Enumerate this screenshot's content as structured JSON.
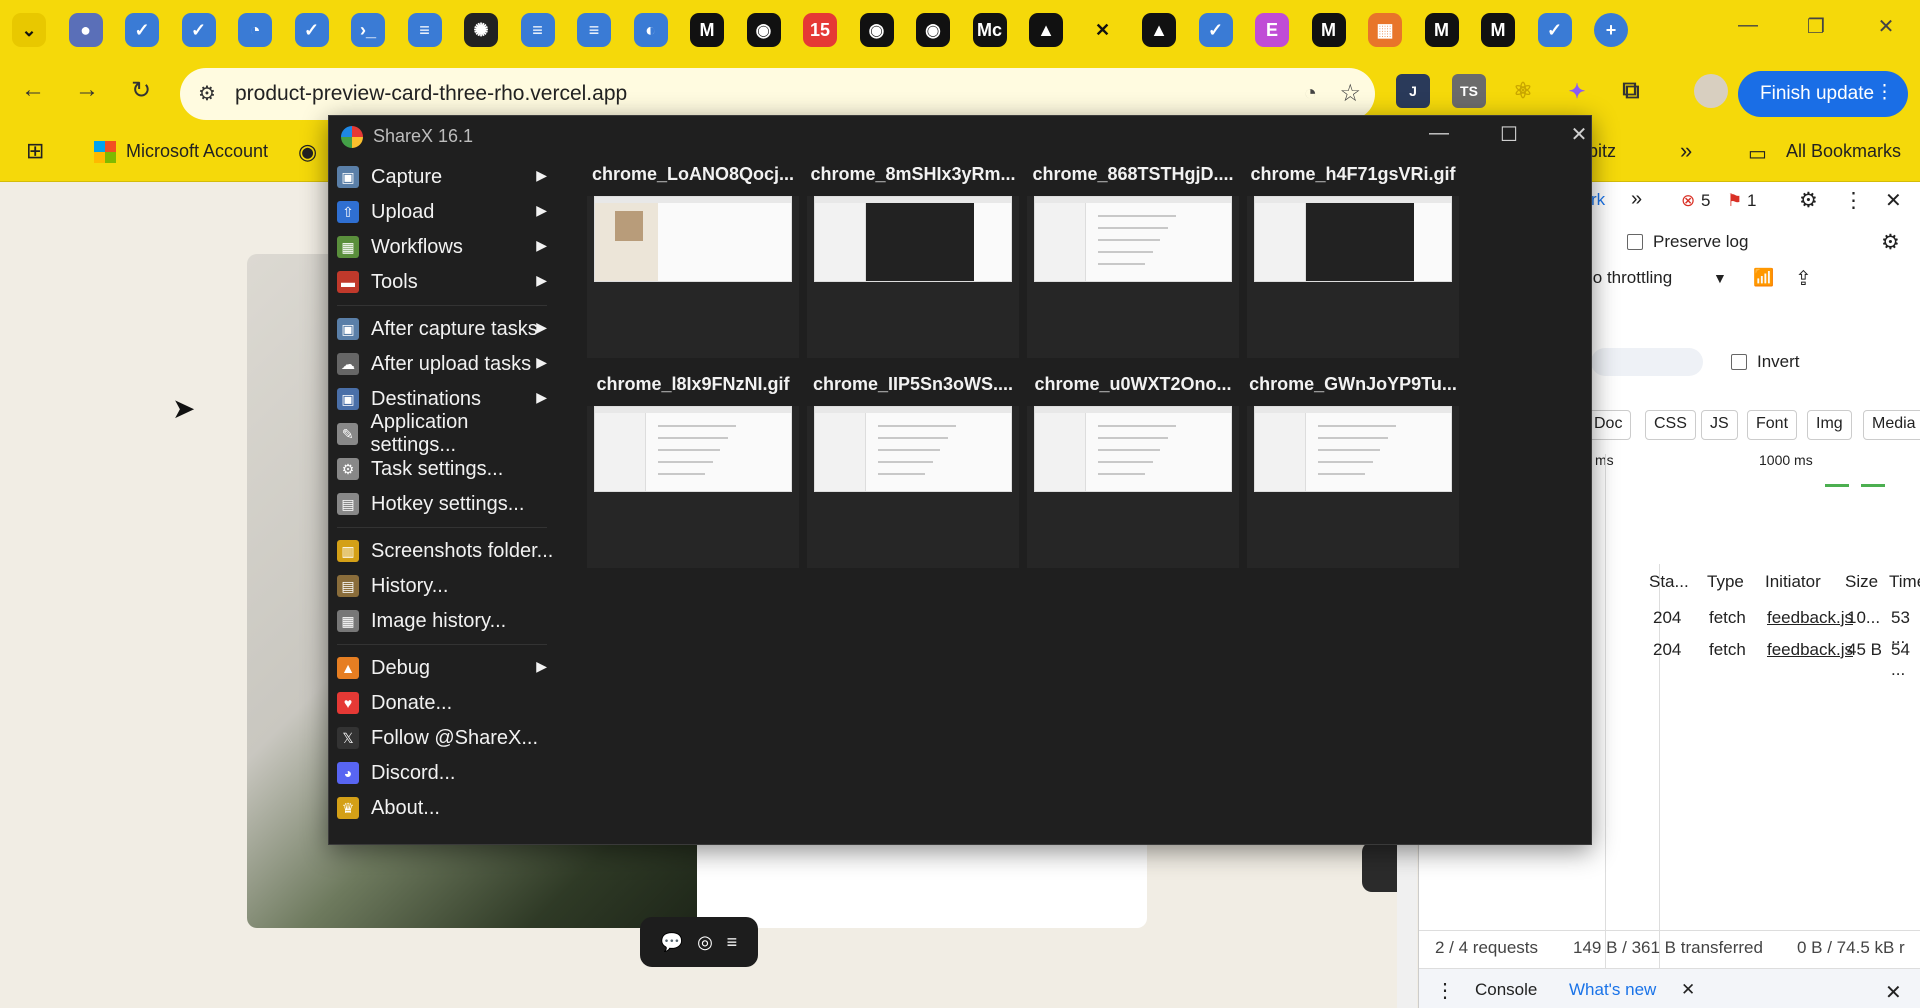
{
  "browser": {
    "tabs": [
      {
        "icon": "tab-search-icon",
        "color": "#f5d90a"
      },
      {
        "icon": "globe-icon",
        "color": "#5a6fb8"
      },
      {
        "icon": "feedback-icon",
        "color": "#3a7bd5"
      },
      {
        "icon": "feedback-icon",
        "color": "#3a7bd5"
      },
      {
        "icon": "meter-icon",
        "color": "#3a7bd5"
      },
      {
        "icon": "feedback-icon",
        "color": "#3a7bd5"
      },
      {
        "icon": "azure-icon",
        "color": "#3a7bd5"
      },
      {
        "icon": "docs-icon",
        "color": "#3a7bd5"
      },
      {
        "icon": "openai-icon",
        "color": "#222222"
      },
      {
        "icon": "docs-icon",
        "color": "#3a7bd5"
      },
      {
        "icon": "docs-round-icon",
        "color": "#3a7bd5"
      },
      {
        "icon": "copilot-icon",
        "color": "#3a7bd5"
      },
      {
        "icon": "m-icon",
        "color": "#111111"
      },
      {
        "icon": "github-icon",
        "color": "#111111"
      },
      {
        "icon": "calendar-icon",
        "color": "#e53935",
        "badge": "15"
      },
      {
        "icon": "github-icon",
        "color": "#111111"
      },
      {
        "icon": "github-icon",
        "color": "#111111"
      },
      {
        "icon": "medium-icon",
        "color": "#111111",
        "text": "Mc"
      },
      {
        "icon": "vercel-icon",
        "color": "#111111"
      },
      {
        "icon": "close-icon",
        "color": "#111111"
      },
      {
        "icon": "vercel-icon",
        "color": "#111111"
      },
      {
        "icon": "feedback-icon",
        "color": "#3a7bd5"
      },
      {
        "icon": "elementor-icon",
        "color": "#c04cd6"
      },
      {
        "icon": "m-icon",
        "color": "#111111"
      },
      {
        "icon": "office-icon",
        "color": "#e8752a"
      },
      {
        "icon": "m-icon",
        "color": "#111111"
      },
      {
        "icon": "m-icon",
        "color": "#111111"
      },
      {
        "icon": "feedback-icon",
        "color": "#3a7bd5"
      }
    ],
    "url": "product-preview-card-three-rho.vercel.app",
    "finish_update": "Finish update",
    "bookmarks": {
      "microsoft_account": "Microsoft Account",
      "abitz": "abitz",
      "all_bookmarks": "All Bookmarks"
    }
  },
  "devtools": {
    "tab_partial": "rk",
    "error_count": "5",
    "issue_count": "1",
    "preserve_log": "Preserve log",
    "throttling": "lo throttling",
    "invert": "Invert",
    "filters": [
      "Doc",
      "CSS",
      "JS",
      "Font",
      "Img",
      "Media"
    ],
    "timeline_ms": "ms",
    "timeline_1000": "1000 ms",
    "columns": [
      "Sta...",
      "Type",
      "Initiator",
      "Size",
      "Time"
    ],
    "rows": [
      {
        "status": "204",
        "type": "fetch",
        "initiator": "feedback.js",
        "size": "10...",
        "time": "53 ..."
      },
      {
        "status": "204",
        "type": "fetch",
        "initiator": "feedback.js",
        "size": "45 B",
        "time": "54 ..."
      }
    ],
    "requests": "2 / 4 requests",
    "transferred": "149 B / 361 B transferred",
    "resources": "0 B / 74.5 kB r",
    "drawer_console": "Console",
    "drawer_whats_new": "What's new"
  },
  "sharex": {
    "title": "ShareX 16.1",
    "menu": [
      {
        "label": "Capture",
        "icon": "capture-icon",
        "submenu": true
      },
      {
        "label": "Upload",
        "icon": "upload-icon",
        "submenu": true
      },
      {
        "label": "Workflows",
        "icon": "workflows-icon",
        "submenu": true
      },
      {
        "label": "Tools",
        "icon": "tools-icon",
        "submenu": true
      },
      {
        "label": "After capture tasks",
        "icon": "after-capture-icon",
        "submenu": true
      },
      {
        "label": "After upload tasks",
        "icon": "after-upload-icon",
        "submenu": true
      },
      {
        "label": "Destinations",
        "icon": "destinations-icon",
        "submenu": true
      },
      {
        "label": "Application settings...",
        "icon": "wrench-icon",
        "submenu": false
      },
      {
        "label": "Task settings...",
        "icon": "gear-icon",
        "submenu": false
      },
      {
        "label": "Hotkey settings...",
        "icon": "keyboard-icon",
        "submenu": false
      },
      {
        "label": "Screenshots folder...",
        "icon": "folder-icon",
        "submenu": false
      },
      {
        "label": "History...",
        "icon": "history-icon",
        "submenu": false
      },
      {
        "label": "Image history...",
        "icon": "image-history-icon",
        "submenu": false
      },
      {
        "label": "Debug",
        "icon": "debug-icon",
        "submenu": true
      },
      {
        "label": "Donate...",
        "icon": "heart-icon",
        "submenu": false
      },
      {
        "label": "Follow @ShareX...",
        "icon": "x-logo-icon",
        "submenu": false
      },
      {
        "label": "Discord...",
        "icon": "discord-icon",
        "submenu": false
      },
      {
        "label": "About...",
        "icon": "crown-icon",
        "submenu": false
      }
    ],
    "thumbnails": [
      {
        "name": "chrome_LoANO8Qocj...",
        "style": "product"
      },
      {
        "name": "chrome_8mSHIx3yRm...",
        "style": "dark"
      },
      {
        "name": "chrome_868TSTHgjD....",
        "style": "light"
      },
      {
        "name": "chrome_h4F71gsVRi.gif",
        "style": "dark"
      },
      {
        "name": "chrome_l8Ix9FNzNI.gif",
        "style": "light"
      },
      {
        "name": "chrome_IIP5Sn3oWS....",
        "style": "light"
      },
      {
        "name": "chrome_u0WXT2Ono...",
        "style": "light"
      },
      {
        "name": "chrome_GWnJoYP9Tu...",
        "style": "light"
      }
    ]
  }
}
